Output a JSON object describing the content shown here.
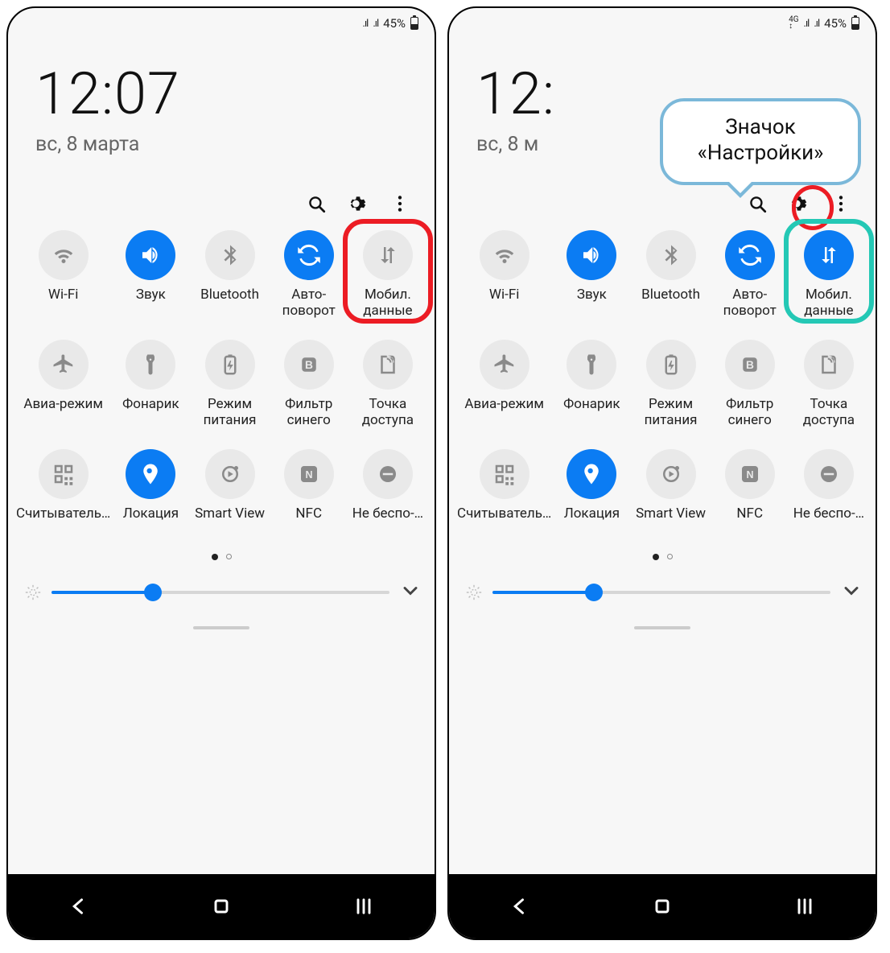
{
  "panels": [
    {
      "statusbar": {
        "show4G": false,
        "battery": "45%"
      },
      "clock": "12:07",
      "date": "вс, 8 марта",
      "tiles": [
        {
          "id": "wifi",
          "label": "Wi-Fi",
          "on": false
        },
        {
          "id": "sound",
          "label": "Звук",
          "on": true
        },
        {
          "id": "bluetooth",
          "label": "Bluetooth",
          "on": false
        },
        {
          "id": "autorotate",
          "label": "Авто-поворот",
          "on": true
        },
        {
          "id": "mobiledata",
          "label": "Мобил. данные",
          "on": false,
          "highlight": "red"
        },
        {
          "id": "airplane",
          "label": "Авиа-режим",
          "on": false
        },
        {
          "id": "flashlight",
          "label": "Фонарик",
          "on": false
        },
        {
          "id": "powermode",
          "label": "Режим питания",
          "on": false
        },
        {
          "id": "bluefilter",
          "label": "Фильтр синего",
          "on": false
        },
        {
          "id": "hotspot",
          "label": "Точка доступа",
          "on": false
        },
        {
          "id": "qrscan",
          "label": "Считыватель…",
          "on": false
        },
        {
          "id": "location",
          "label": "Локация",
          "on": true
        },
        {
          "id": "smartview",
          "label": "Smart View",
          "on": false
        },
        {
          "id": "nfc",
          "label": "NFC",
          "on": false
        },
        {
          "id": "dnd",
          "label": "Не беспо-…",
          "on": false
        }
      ],
      "gearHighlight": false,
      "speech": null
    },
    {
      "statusbar": {
        "show4G": true,
        "battery": "45%"
      },
      "clock": "12:",
      "date": "вс, 8 м",
      "tiles": [
        {
          "id": "wifi",
          "label": "Wi-Fi",
          "on": false
        },
        {
          "id": "sound",
          "label": "Звук",
          "on": true
        },
        {
          "id": "bluetooth",
          "label": "Bluetooth",
          "on": false
        },
        {
          "id": "autorotate",
          "label": "Авто-поворот",
          "on": true
        },
        {
          "id": "mobiledata",
          "label": "Мобил. данные",
          "on": true,
          "highlight": "teal"
        },
        {
          "id": "airplane",
          "label": "Авиа-режим",
          "on": false
        },
        {
          "id": "flashlight",
          "label": "Фонарик",
          "on": false
        },
        {
          "id": "powermode",
          "label": "Режим питания",
          "on": false
        },
        {
          "id": "bluefilter",
          "label": "Фильтр синего",
          "on": false
        },
        {
          "id": "hotspot",
          "label": "Точка доступа",
          "on": false
        },
        {
          "id": "qrscan",
          "label": "Считыватель…",
          "on": false
        },
        {
          "id": "location",
          "label": "Локация",
          "on": true
        },
        {
          "id": "smartview",
          "label": "Smart View",
          "on": false
        },
        {
          "id": "nfc",
          "label": "NFC",
          "on": false
        },
        {
          "id": "dnd",
          "label": "Не беспо-…",
          "on": false
        }
      ],
      "gearHighlight": true,
      "speech": "Значок «Настройки»"
    }
  ],
  "brightnessPercent": 30,
  "icons": {
    "wifi": "wifi-icon",
    "sound": "sound-icon",
    "bluetooth": "bluetooth-icon",
    "autorotate": "rotate-icon",
    "mobiledata": "data-arrows-icon",
    "airplane": "airplane-icon",
    "flashlight": "flashlight-icon",
    "powermode": "battery-leaf-icon",
    "bluefilter": "bluelight-icon",
    "hotspot": "hotspot-icon",
    "qrscan": "qr-icon",
    "location": "location-pin-icon",
    "smartview": "smartview-icon",
    "nfc": "nfc-icon",
    "dnd": "dnd-icon"
  }
}
